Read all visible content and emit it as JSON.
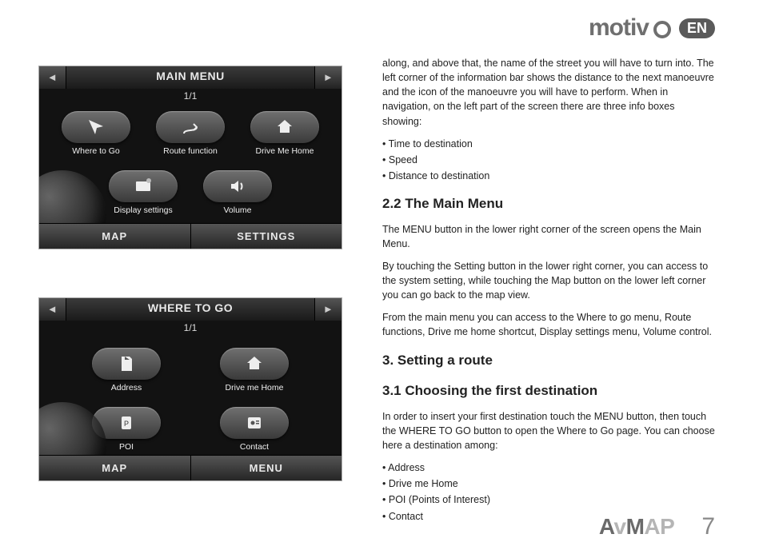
{
  "header": {
    "brand": "motiv",
    "lang": "EN"
  },
  "screens": {
    "main": {
      "title": "MAIN MENU",
      "page": "1/1",
      "buttons": [
        {
          "label": "Where to Go",
          "icon": "pointer"
        },
        {
          "label": "Route function",
          "icon": "route"
        },
        {
          "label": "Drive Me Home",
          "icon": "home"
        },
        {
          "label": "Display settings",
          "icon": "display"
        },
        {
          "label": "Volume",
          "icon": "volume"
        }
      ],
      "footer": [
        "MAP",
        "SETTINGS"
      ]
    },
    "where": {
      "title": "WHERE TO GO",
      "page": "1/1",
      "buttons": [
        {
          "label": "Address",
          "icon": "address"
        },
        {
          "label": "Drive me Home",
          "icon": "home"
        },
        {
          "label": "POI",
          "icon": "poi"
        },
        {
          "label": "Contact",
          "icon": "contact"
        }
      ],
      "footer": [
        "MAP",
        "MENU"
      ]
    }
  },
  "text": {
    "p1": "along, and above that, the name of the street you will have to turn into. The left corner of the information bar shows the distance to the next manoeuvre and the icon of the manoeuvre you will have to perform. When in navigation, on the left part of the screen there are three info boxes showing:",
    "list1": [
      "Time to destination",
      "Speed",
      "Distance to destination"
    ],
    "h22": "2.2 The Main Menu",
    "p2": "The MENU button in the lower right corner of the screen opens the Main Menu.",
    "p3": "By touching the Setting button in the lower right corner, you can access to the system setting, while touching the Map button on the lower left corner you can go back to the map view.",
    "p4": "From the main menu you can access to the Where to go menu, Route functions, Drive me home shortcut, Display settings menu, Volume control.",
    "h3": "3. Setting a route",
    "h31": "3.1 Choosing the first destination",
    "p5": "In order to insert your first destination touch the MENU button, then touch the WHERE TO GO button to open the Where to Go page. You can choose here a destination among:",
    "list2": [
      "Address",
      "Drive me Home",
      "POI (Points of Interest)",
      "Contact"
    ]
  },
  "footer": {
    "brand_a": "A",
    "brand_v": "v",
    "brand_m": "M",
    "brand_ap": "AP",
    "page": "7"
  }
}
